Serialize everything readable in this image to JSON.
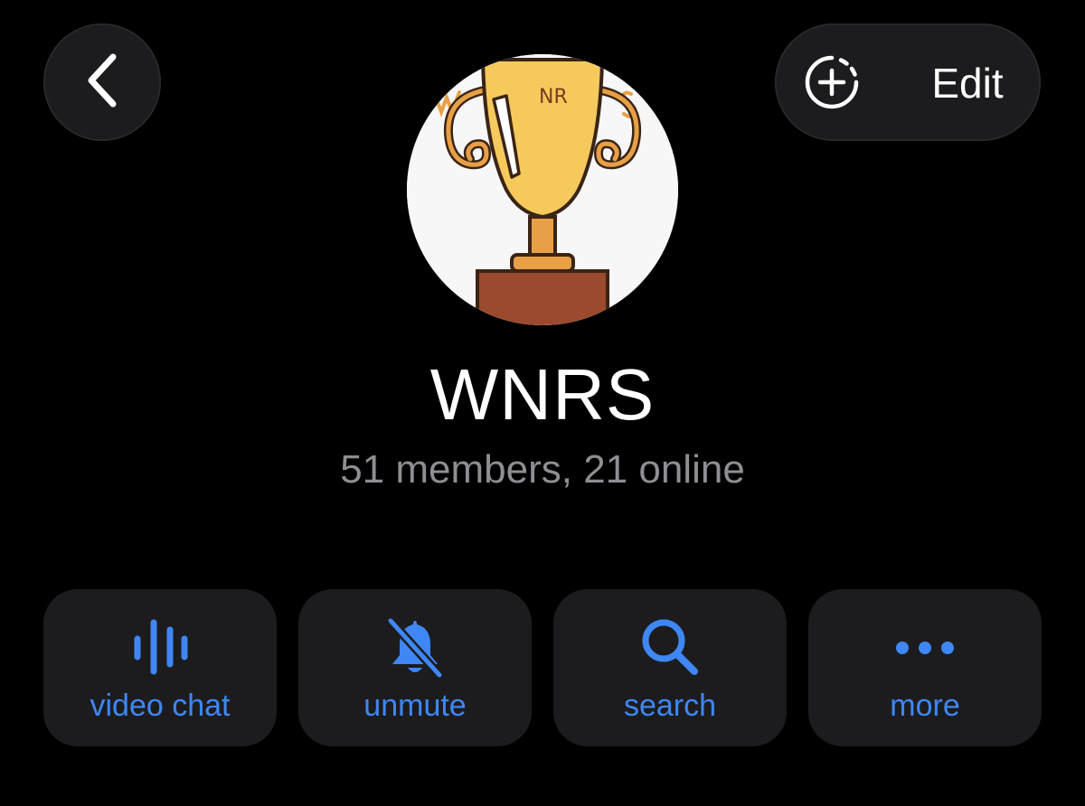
{
  "header": {
    "back_icon": "chevron-left-icon",
    "story_icon": "add-story-icon",
    "edit_label": "Edit"
  },
  "avatar": {
    "description_icon": "trophy-icon",
    "lettering": [
      "W",
      "NR",
      "S"
    ],
    "colors": {
      "trophy": "#f6c95c",
      "trophy_outline": "#3a2416",
      "handles": "#e8a046",
      "base": "#9b4a2e"
    }
  },
  "profile": {
    "name": "WNRS",
    "status": "51 members, 21 online"
  },
  "actions": [
    {
      "label": "video chat",
      "icon": "voice-chat-icon"
    },
    {
      "label": "unmute",
      "icon": "bell-slash-icon"
    },
    {
      "label": "search",
      "icon": "search-icon"
    },
    {
      "label": "more",
      "icon": "more-dots-icon"
    }
  ],
  "colors": {
    "background": "#000000",
    "surface": "#1c1c1e",
    "accent": "#3e87f5",
    "text": "#ffffff",
    "secondary_text": "#8e8e93"
  }
}
